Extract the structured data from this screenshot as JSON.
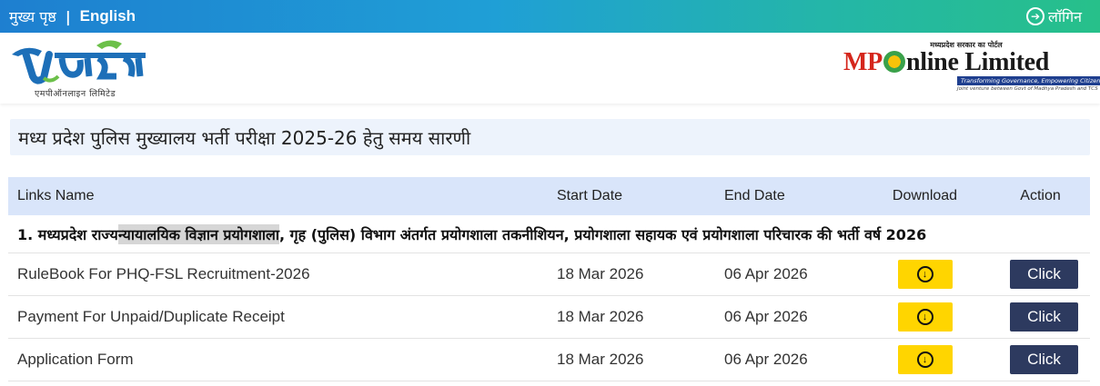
{
  "topbar": {
    "home_label": "मुख्य पृष्ठ",
    "separator": "|",
    "english_label": "English",
    "login_label": "लॉगिन"
  },
  "brand": {
    "left_subtitle": "एमपीऑनलाइन लिमिटेड",
    "right_tagline": "मध्यप्रदेश सरकार का पोर्टल",
    "right_name_mp": "MP",
    "right_name_rest": "nline Limited",
    "right_slogan": "Transforming Governance, Empowering Citizens",
    "right_joint": "Joint venture between Govt of Madhya Pradesh and TCS"
  },
  "page_title": "मध्य प्रदेश पुलिस मुख्यालय भर्ती परीक्षा 2025-26 हेतु समय सारणी",
  "table": {
    "headers": {
      "name": "Links Name",
      "start": "Start Date",
      "end": "End Date",
      "download": "Download",
      "action": "Action"
    },
    "section": {
      "prefix": "1. मध्यप्रदेश राज्य ",
      "highlight": "न्यायालयिक विज्ञान प्रयोगशाला",
      "suffix": ", गृह (पुलिस) विभाग अंतर्गत प्रयोगशाला तकनीशियन, प्रयोगशाला सहायक एवं प्रयोगशाला परिचारक की भर्ती वर्ष 2026"
    },
    "rows": [
      {
        "name": "RuleBook For PHQ-FSL Recruitment-2026",
        "start": "18 Mar 2026",
        "end": "06 Apr 2026",
        "action": "Click"
      },
      {
        "name": "Payment For Unpaid/Duplicate Receipt",
        "start": "18 Mar 2026",
        "end": "06 Apr 2026",
        "action": "Click"
      },
      {
        "name": "Application Form",
        "start": "18 Mar 2026",
        "end": "06 Apr 2026",
        "action": "Click"
      }
    ]
  },
  "colors": {
    "download_button": "#ffd500",
    "action_button": "#2d3a5f",
    "header_row": "#d9e5fa",
    "title_bg": "#edf3fc"
  },
  "icons": {
    "login": "login-arrow-icon",
    "download": "download-circle-icon"
  }
}
